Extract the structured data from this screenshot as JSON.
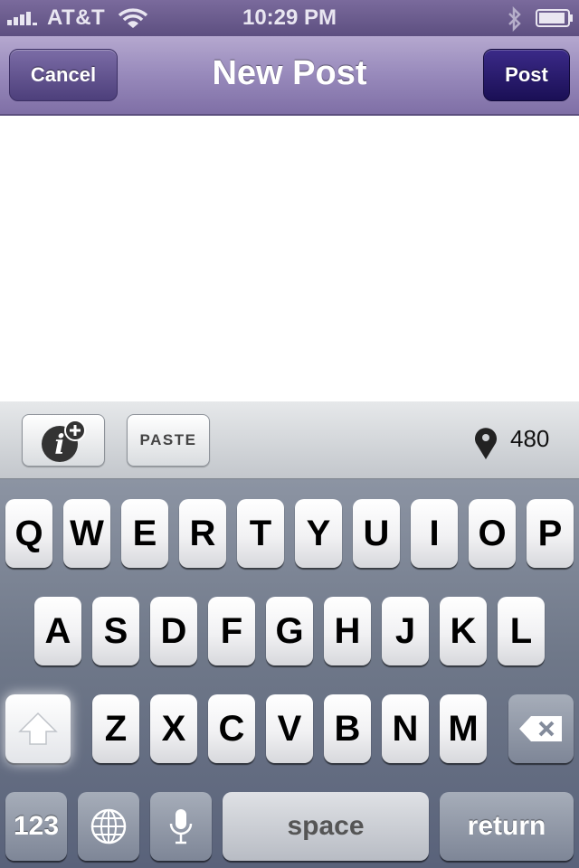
{
  "status_bar": {
    "carrier": "AT&T",
    "time": "10:29 PM",
    "signal_icon": "signal-bars-icon",
    "wifi_icon": "wifi-icon",
    "bluetooth_icon": "bluetooth-icon",
    "battery_icon": "battery-icon"
  },
  "nav": {
    "title": "New Post",
    "cancel_label": "Cancel",
    "post_label": "Post"
  },
  "editor": {
    "text": ""
  },
  "toolbar": {
    "info_icon": "info-plus-icon",
    "paste_label": "PASTE",
    "location_icon": "location-pin-icon",
    "char_count": "480"
  },
  "keyboard": {
    "row1": [
      "Q",
      "W",
      "E",
      "R",
      "T",
      "Y",
      "U",
      "I",
      "O",
      "P"
    ],
    "row2": [
      "A",
      "S",
      "D",
      "F",
      "G",
      "H",
      "J",
      "K",
      "L"
    ],
    "row3": [
      "Z",
      "X",
      "C",
      "V",
      "B",
      "N",
      "M"
    ],
    "numbers_label": "123",
    "space_label": "space",
    "return_label": "return",
    "shift_icon": "shift-arrow-icon",
    "delete_icon": "delete-icon",
    "globe_icon": "globe-icon",
    "mic_icon": "microphone-icon"
  },
  "colors": {
    "nav_accent": "#8e80b5",
    "post_button": "#24166a",
    "keyboard_bg": "#6f7889"
  }
}
